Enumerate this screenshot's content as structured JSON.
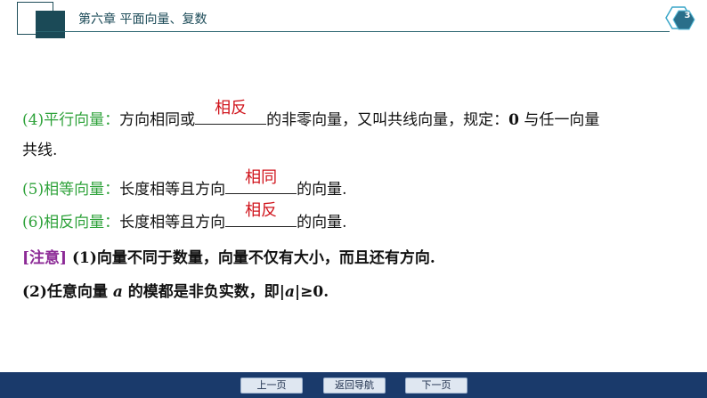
{
  "header": {
    "chapter_title": "第六章    平面向量、复数",
    "page_number": "3"
  },
  "content": {
    "line1": {
      "label": "(4)平行向量：",
      "pre": "方向相同或",
      "answer": "相反",
      "post": "的非零向量，又叫共线向量，规定：",
      "zero": "0",
      "post2": " 与任一向量"
    },
    "line2": {
      "text": "共线."
    },
    "line3": {
      "label": "(5)相等向量：",
      "pre": "长度相等且方向",
      "answer": "相同",
      "post": "的向量."
    },
    "line4": {
      "label": "(6)相反向量：",
      "pre": "长度相等且方向",
      "answer": "相反",
      "post": "的向量."
    },
    "line5": {
      "tag": "[注意]",
      "text": "  (1)向量不同于数量，向量不仅有大小，而且还有方向."
    },
    "line6": {
      "pre": "(2)任意向量 ",
      "var": "a",
      "mid": " 的模都是非负实数，即|",
      "var2": "a",
      "post": "|≥0."
    }
  },
  "nav": {
    "prev": "上一页",
    "home": "返回导航",
    "next": "下一页"
  },
  "colors": {
    "header": "#1b4a57",
    "label_green": "#2ea23a",
    "answer_red": "#d0141c",
    "note_purple": "#8c2a96",
    "nav_bar": "#1a3a6b"
  }
}
